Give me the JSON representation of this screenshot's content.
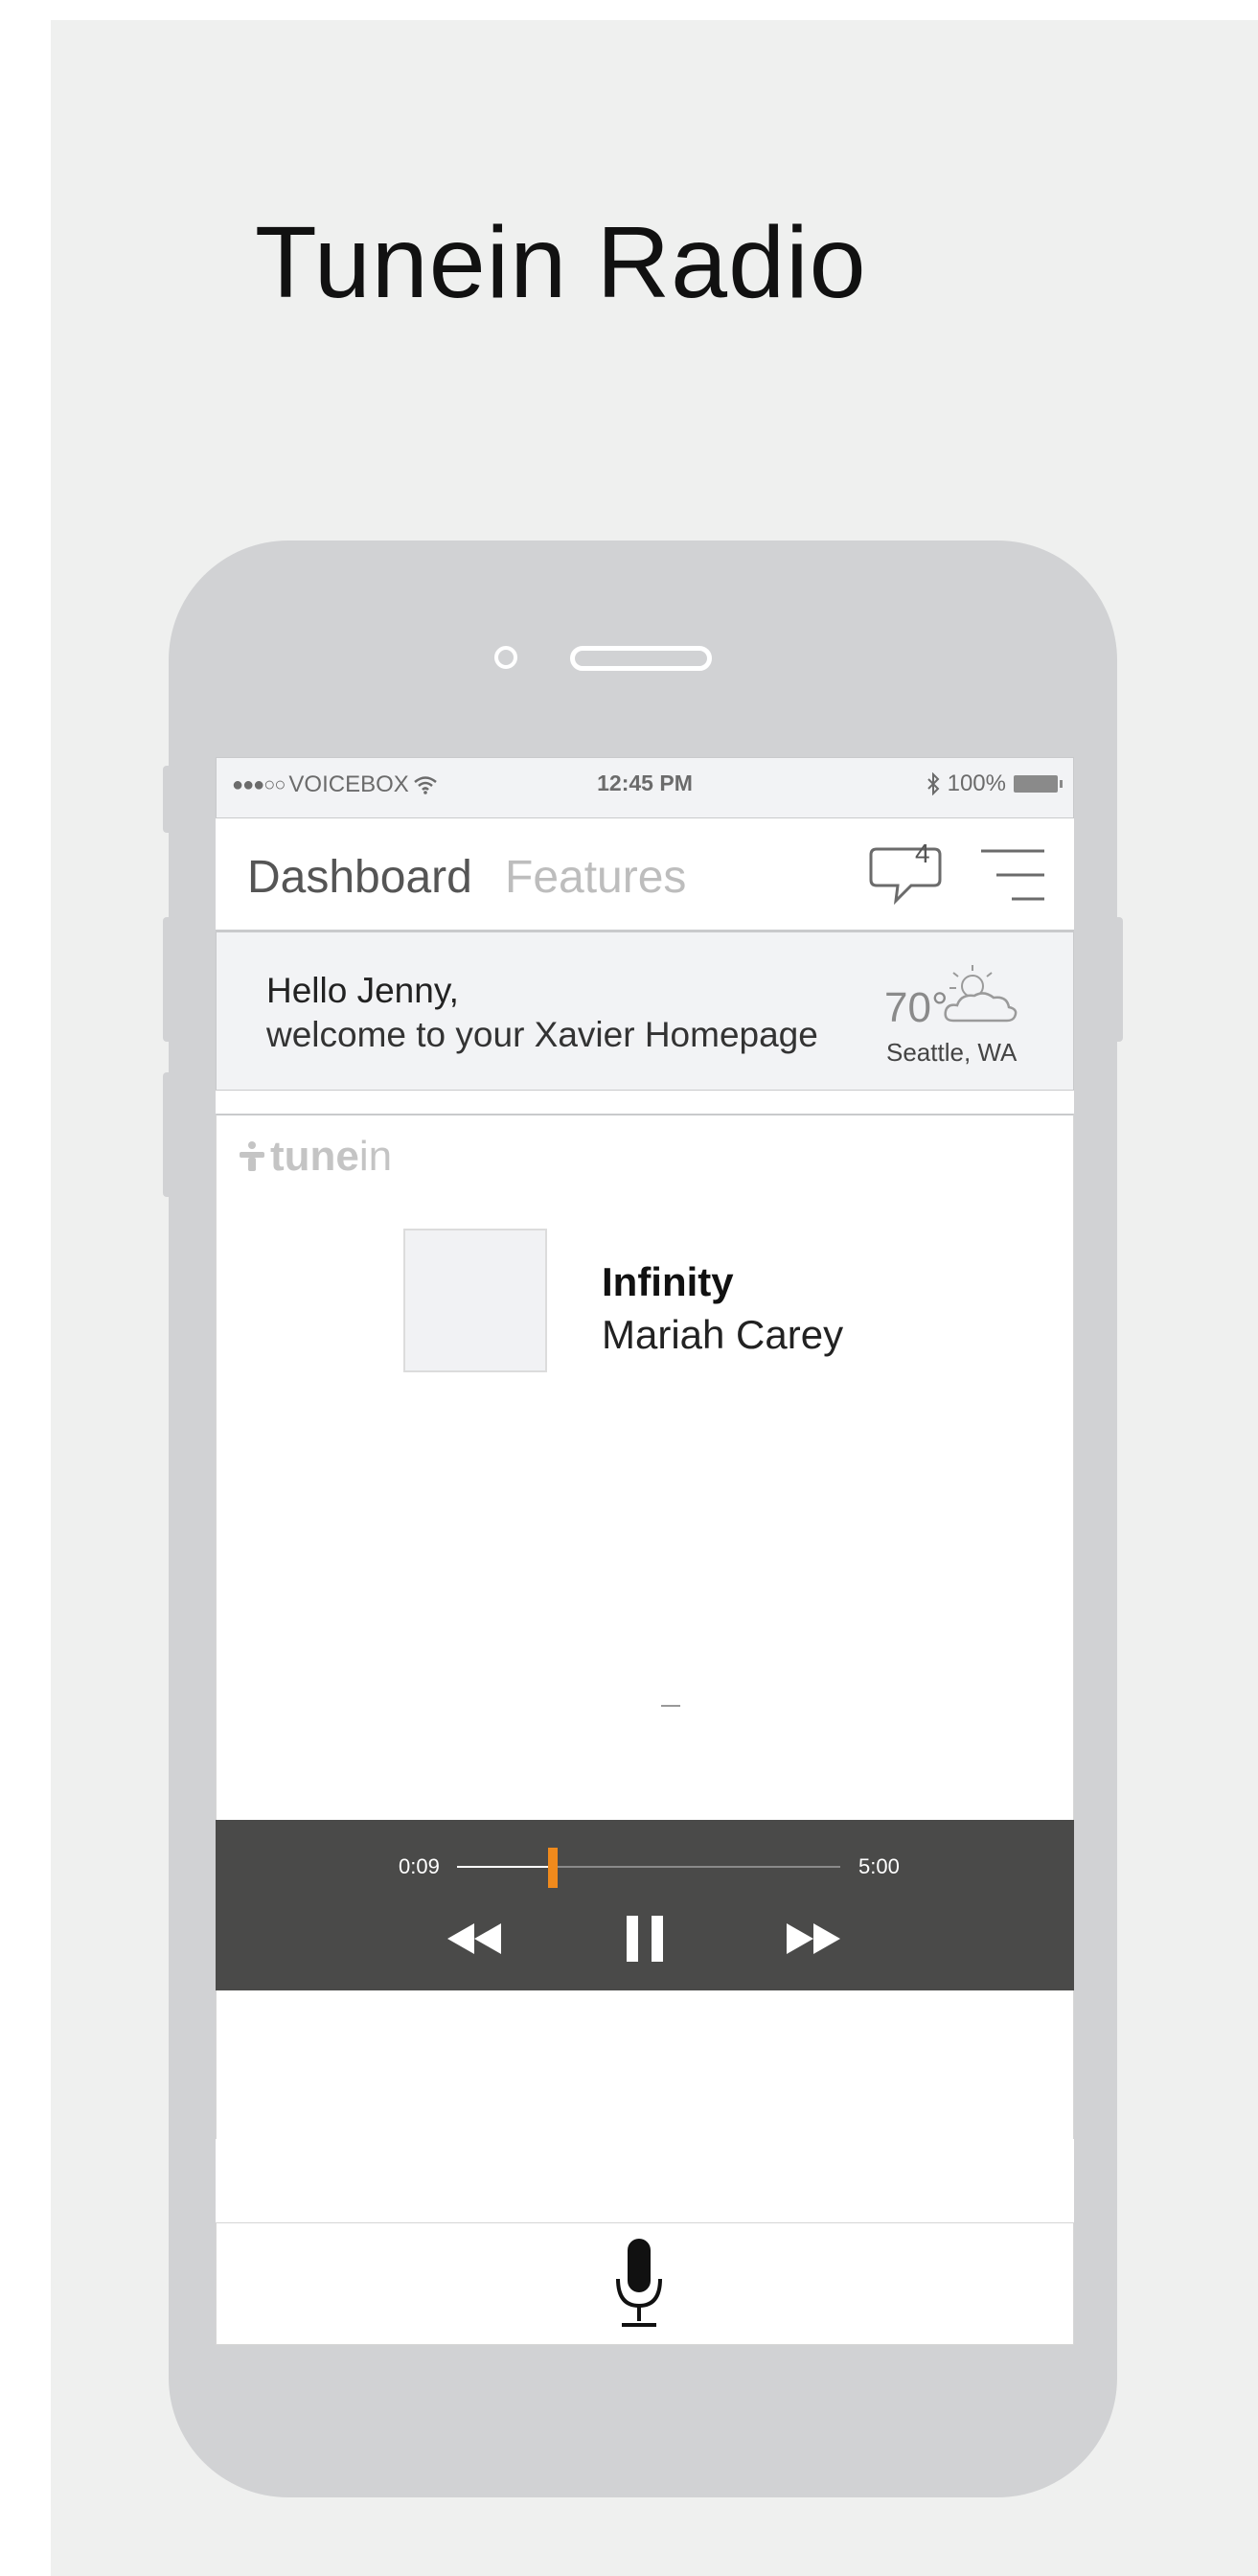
{
  "page": {
    "title": "Tunein Radio"
  },
  "status_bar": {
    "signal": "●●●○○",
    "carrier": "VOICEBOX",
    "time": "12:45 PM",
    "battery": "100%",
    "icons": [
      "wifi-icon",
      "bluetooth-icon",
      "battery-icon"
    ]
  },
  "header": {
    "tabs": [
      {
        "label": "Dashboard",
        "active": true
      },
      {
        "label": "Features",
        "active": false
      }
    ],
    "notification_count": "4",
    "icons": [
      "chat-bubble-icon",
      "menu-icon"
    ]
  },
  "welcome": {
    "greeting": "Hello Jenny,",
    "message": "welcome to your Xavier Homepage",
    "temperature": "70°",
    "city": "Seattle, WA",
    "weather_icon": "partly-cloudy-icon"
  },
  "tunein": {
    "logo_bold": "tune",
    "logo_light": "in",
    "track_title": "Infinity",
    "artist": "Mariah Carey",
    "elapsed": "0:09",
    "duration": "5:00",
    "progress": 0.25,
    "controls": [
      "rewind-icon",
      "pause-icon",
      "fast-forward-icon"
    ]
  },
  "voice": {
    "icon": "microphone-icon"
  },
  "colors": {
    "background": "#eff0ef",
    "phone_body": "#d1d2d4",
    "player_bg": "#4a4a49",
    "accent": "#f08a1c",
    "inactive_tab": "#bdbdbd"
  }
}
